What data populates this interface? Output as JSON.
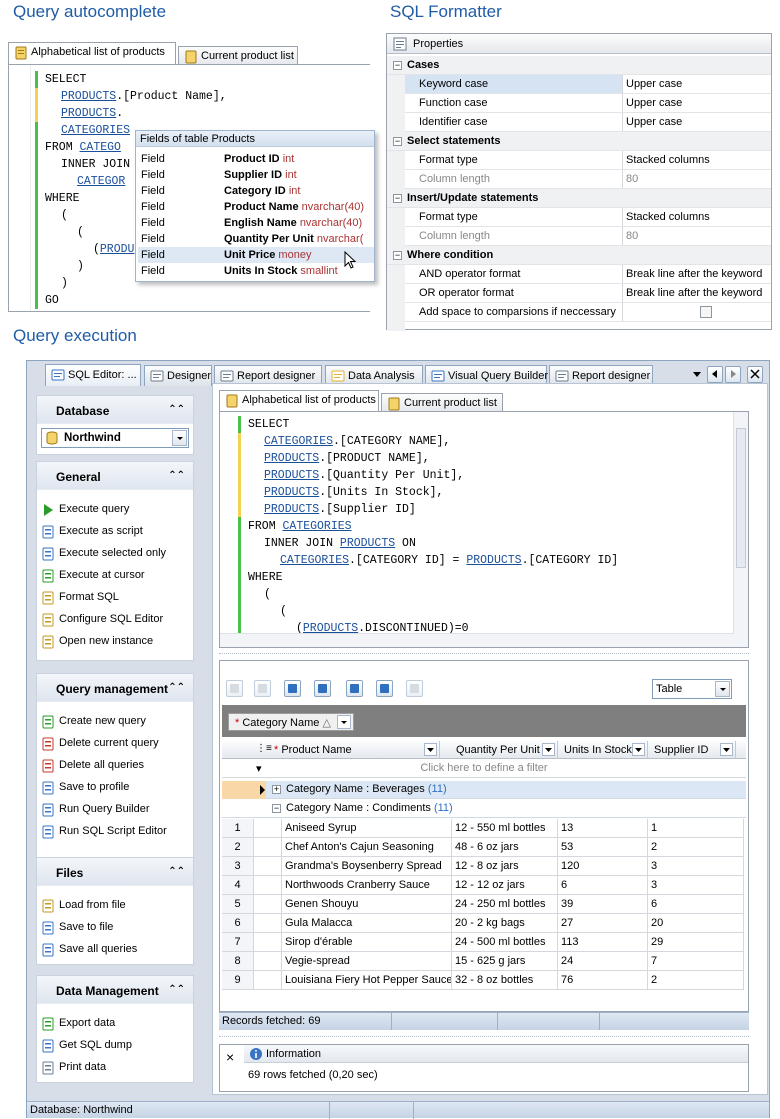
{
  "titles": {
    "autocomplete": "Query autocomplete",
    "formatter": "SQL Formatter",
    "execution": "Query execution"
  },
  "autocomplete": {
    "tabs": [
      "Alphabetical list of products",
      "Current product list"
    ],
    "code": [
      {
        "t": "SELECT",
        "i": 0
      },
      {
        "t": "PRODUCTS.[Product Name],",
        "i": 1,
        "link": "PRODUCTS"
      },
      {
        "t": "PRODUCTS.",
        "i": 1,
        "link": "PRODUCTS"
      },
      {
        "t": "CATEGORIES",
        "i": 1,
        "link": "CATEGORIES"
      },
      {
        "t": "FROM CATEGO",
        "i": 0,
        "link": "CATEGO"
      },
      {
        "t": "INNER JOIN",
        "i": 1
      },
      {
        "t": "CATEGOR",
        "i": 2,
        "link": "CATEGOR"
      },
      {
        "t": "WHERE",
        "i": 0
      },
      {
        "t": "(",
        "i": 1
      },
      {
        "t": "(",
        "i": 2
      },
      {
        "t": "(PRODU",
        "i": 3,
        "link": "PRODU"
      },
      {
        "t": ")",
        "i": 2
      },
      {
        "t": ")",
        "i": 1
      },
      {
        "t": "GO",
        "i": 0
      }
    ],
    "popup": {
      "title": "Fields of table Products",
      "rows": [
        {
          "kind": "Field",
          "name": "Product ID",
          "type": "int"
        },
        {
          "kind": "Field",
          "name": "Supplier ID",
          "type": "int"
        },
        {
          "kind": "Field",
          "name": "Category ID",
          "type": "int"
        },
        {
          "kind": "Field",
          "name": "Product Name",
          "type": "nvarchar(40)"
        },
        {
          "kind": "Field",
          "name": "English Name",
          "type": "nvarchar(40)"
        },
        {
          "kind": "Field",
          "name": "Quantity Per Unit",
          "type": "nvarchar("
        },
        {
          "kind": "Field",
          "name": "Unit Price",
          "type": "money"
        },
        {
          "kind": "Field",
          "name": "Units In Stock",
          "type": "smallint"
        }
      ]
    }
  },
  "formatter": {
    "header": "Properties",
    "sections": [
      {
        "title": "Cases",
        "rows": [
          [
            "Keyword case",
            "Upper case",
            false
          ],
          [
            "Function case",
            "Upper case",
            false
          ],
          [
            "Identifier case",
            "Upper case",
            false
          ]
        ]
      },
      {
        "title": "Select statements",
        "rows": [
          [
            "Format type",
            "Stacked columns",
            false
          ],
          [
            "Column length",
            "80",
            true
          ]
        ]
      },
      {
        "title": "Insert/Update statements",
        "rows": [
          [
            "Format type",
            "Stacked columns",
            false
          ],
          [
            "Column length",
            "80",
            true
          ]
        ]
      },
      {
        "title": "Where condition",
        "rows": [
          [
            "AND operator format",
            "Break line after the keyword",
            false
          ],
          [
            "OR operator format",
            "Break line after the keyword",
            false
          ],
          [
            "Add space to comparsions if neccessary",
            "",
            false
          ]
        ]
      }
    ]
  },
  "execution": {
    "tabs": [
      "SQL Editor: ...",
      "Designer",
      "Report designer",
      "Data Analysis",
      "Visual Query Builder",
      "Report designer"
    ],
    "sidebar": {
      "database": {
        "title": "Database",
        "value": "Northwind"
      },
      "general": {
        "title": "General",
        "items": [
          "Execute query",
          "Execute as script",
          "Execute selected only",
          "Execute at cursor",
          "Format SQL",
          "Configure SQL Editor",
          "Open new instance"
        ]
      },
      "query_mgmt": {
        "title": "Query management",
        "items": [
          "Create new query",
          "Delete current query",
          "Delete all queries",
          "Save to profile",
          "Run Query Builder",
          "Run SQL Script Editor"
        ]
      },
      "files": {
        "title": "Files",
        "items": [
          "Load from file",
          "Save to file",
          "Save all queries"
        ]
      },
      "data_mgmt": {
        "title": "Data Management",
        "items": [
          "Export data",
          "Get SQL dump",
          "Print data"
        ]
      }
    },
    "editor_tabs": [
      "Alphabetical list of products",
      "Current product list"
    ],
    "code": [
      {
        "t": "SELECT",
        "i": 0
      },
      {
        "t": "CATEGORIES.[CATEGORY NAME],",
        "i": 1,
        "link": "CATEGORIES"
      },
      {
        "t": "PRODUCTS.[PRODUCT NAME],",
        "i": 1,
        "link": "PRODUCTS"
      },
      {
        "t": "PRODUCTS.[Quantity Per Unit],",
        "i": 1,
        "link": "PRODUCTS"
      },
      {
        "t": "PRODUCTS.[Units In Stock],",
        "i": 1,
        "link": "PRODUCTS"
      },
      {
        "t": "PRODUCTS.[Supplier ID]",
        "i": 1,
        "link": "PRODUCTS"
      },
      {
        "t": "FROM CATEGORIES",
        "i": 0,
        "link": "CATEGORIES"
      },
      {
        "t": "INNER JOIN PRODUCTS ON",
        "i": 1,
        "link": "PRODUCTS"
      },
      {
        "t": "CATEGORIES.[CATEGORY ID] = PRODUCTS.[CATEGORY ID]",
        "i": 2,
        "link": "CATEGORIES",
        "link2": "PRODUCTS"
      },
      {
        "t": "WHERE",
        "i": 0
      },
      {
        "t": "(",
        "i": 1
      },
      {
        "t": "(",
        "i": 2
      },
      {
        "t": "(PRODUCTS.DISCONTINUED)=0",
        "i": 3,
        "link": "PRODUCTS"
      }
    ],
    "view_select": "Table",
    "group_by": "Category Name",
    "columns": [
      "Product Name",
      "Quantity Per Unit",
      "Units In Stock",
      "Supplier ID"
    ],
    "filter_hint": "Click here to define a filter",
    "groups": [
      {
        "label": "Category Name : Beverages",
        "count": "(11)"
      },
      {
        "label": "Category Name : Condiments",
        "count": "(11)"
      }
    ],
    "rows": [
      [
        "1",
        "Aniseed Syrup",
        "12 - 550 ml bottles",
        "13",
        "1"
      ],
      [
        "2",
        "Chef Anton's Cajun Seasoning",
        "48 - 6 oz jars",
        "53",
        "2"
      ],
      [
        "3",
        "Grandma's Boysenberry Spread",
        "12 - 8 oz jars",
        "120",
        "3"
      ],
      [
        "4",
        "Northwoods Cranberry Sauce",
        "12 - 12 oz jars",
        "6",
        "3"
      ],
      [
        "5",
        "Genen Shouyu",
        "24 - 250 ml bottles",
        "39",
        "6"
      ],
      [
        "6",
        "Gula Malacca",
        "20 - 2 kg bags",
        "27",
        "20"
      ],
      [
        "7",
        "Sirop d'érable",
        "24 - 500 ml bottles",
        "113",
        "29"
      ],
      [
        "8",
        "Vegie-spread",
        "15 - 625 g jars",
        "24",
        "7"
      ],
      [
        "9",
        "Louisiana Fiery Hot Pepper Sauce",
        "32 - 8 oz bottles",
        "76",
        "2"
      ]
    ],
    "records": "Records fetched: 69",
    "info_title": "Information",
    "info_text": "69 rows fetched (0,20 sec)",
    "status": "Database: Northwind"
  }
}
